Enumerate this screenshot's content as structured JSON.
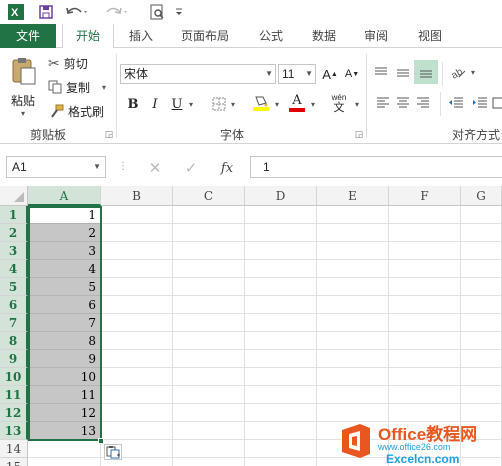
{
  "qat": {
    "icons": [
      "excel-logo-icon",
      "save-icon",
      "undo-icon",
      "redo-icon",
      "print-preview-icon",
      "customize-icon"
    ]
  },
  "tabs": [
    {
      "label": "文件",
      "kind": "file"
    },
    {
      "label": "开始",
      "kind": "active"
    },
    {
      "label": "插入",
      "kind": ""
    },
    {
      "label": "页面布局",
      "kind": ""
    },
    {
      "label": "公式",
      "kind": ""
    },
    {
      "label": "数据",
      "kind": ""
    },
    {
      "label": "审阅",
      "kind": ""
    },
    {
      "label": "视图",
      "kind": ""
    }
  ],
  "ribbon": {
    "clipboard": {
      "paste_label": "粘贴",
      "cut_label": "剪切",
      "copy_label": "复制",
      "format_painter_label": "格式刷",
      "group_label": "剪贴板"
    },
    "font": {
      "font_name": "宋体",
      "font_size": "11",
      "bold": "B",
      "italic": "I",
      "underline": "U",
      "phonetic_top": "wén",
      "phonetic_bottom": "文",
      "group_label": "字体"
    },
    "alignment": {
      "group_label": "对齐方式"
    }
  },
  "formula_bar": {
    "name_box": "A1",
    "fx_label": "fx",
    "value": "1"
  },
  "grid": {
    "columns": [
      "A",
      "B",
      "C",
      "D",
      "E",
      "F",
      "G"
    ],
    "rows": [
      "1",
      "2",
      "3",
      "4",
      "5",
      "6",
      "7",
      "8",
      "9",
      "10",
      "11",
      "12",
      "13",
      "14",
      "15"
    ],
    "column_a_values": [
      "1",
      "2",
      "3",
      "4",
      "5",
      "6",
      "7",
      "8",
      "9",
      "10",
      "11",
      "12",
      "13"
    ]
  },
  "watermark": {
    "title": "Office教程网",
    "url": "www.office26.com",
    "site": "Excelcn.com"
  },
  "colors": {
    "accent": "#217346",
    "watermark_orange": "#e8571f",
    "watermark_blue": "#1fa0e0"
  }
}
